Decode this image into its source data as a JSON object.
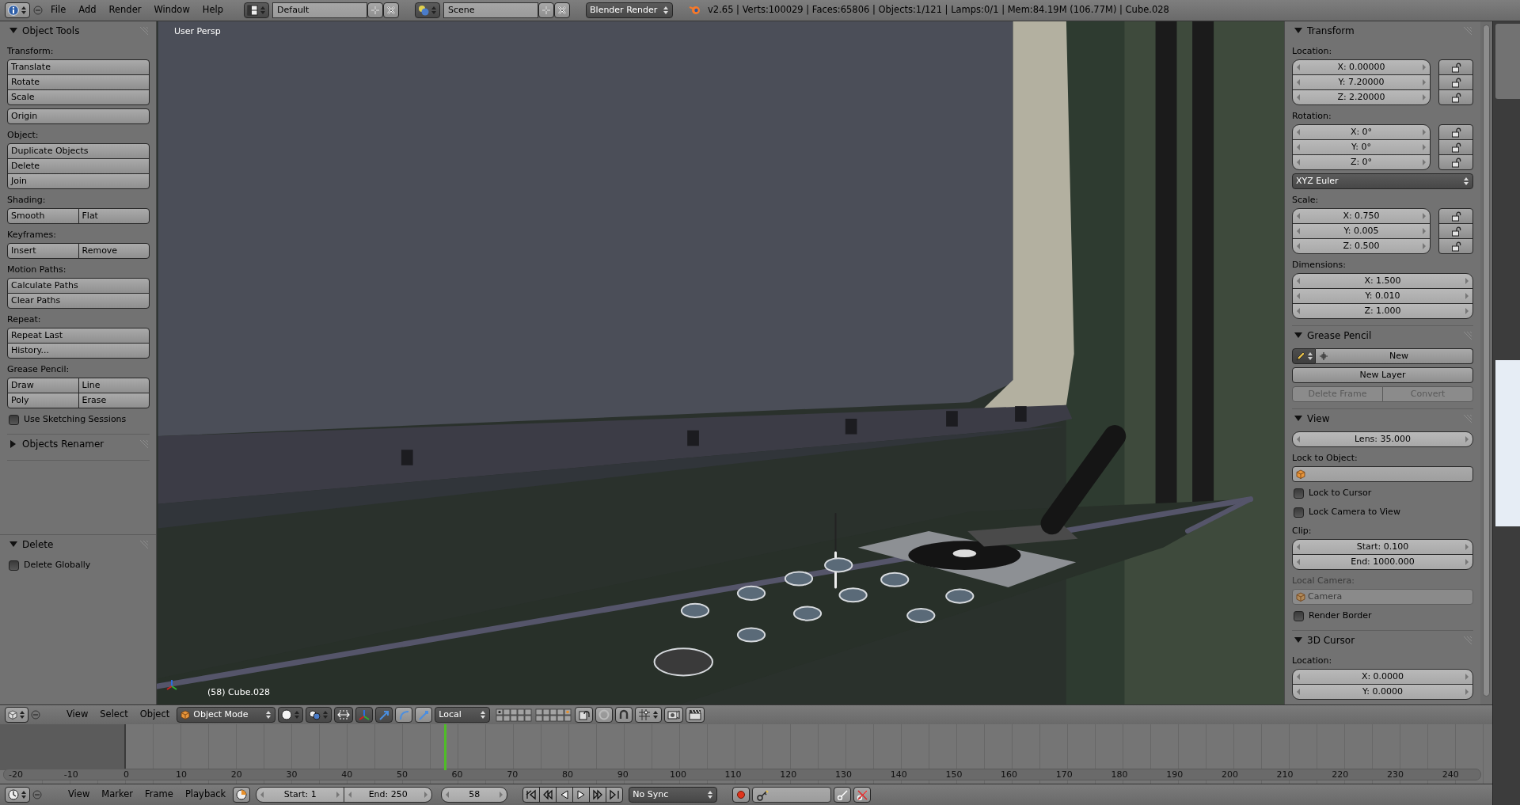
{
  "top_bar": {
    "menus": [
      "File",
      "Add",
      "Render",
      "Window",
      "Help"
    ],
    "screen_layout": "Default",
    "scene": "Scene",
    "render_engine": "Blender Render",
    "stats": "v2.65 | Verts:100029 | Faces:65806 | Objects:1/121 | Lamps:0/1 | Mem:84.19M (106.77M) | Cube.028"
  },
  "tool_shelf": {
    "panels": [
      {
        "title": "Object Tools",
        "expanded": true,
        "items": [
          {
            "kind": "label",
            "text": "Transform:"
          },
          {
            "kind": "buttons",
            "rows": [
              [
                "Translate"
              ],
              [
                "Rotate"
              ],
              [
                "Scale"
              ]
            ]
          },
          {
            "kind": "buttons",
            "rows": [
              [
                "Origin"
              ]
            ]
          },
          {
            "kind": "label",
            "text": "Object:"
          },
          {
            "kind": "buttons",
            "rows": [
              [
                "Duplicate Objects"
              ],
              [
                "Delete"
              ],
              [
                "Join"
              ]
            ]
          },
          {
            "kind": "label",
            "text": "Shading:"
          },
          {
            "kind": "buttons",
            "rows": [
              [
                "Smooth",
                "Flat"
              ]
            ]
          },
          {
            "kind": "label",
            "text": "Keyframes:"
          },
          {
            "kind": "buttons",
            "rows": [
              [
                "Insert",
                "Remove"
              ]
            ]
          },
          {
            "kind": "label",
            "text": "Motion Paths:"
          },
          {
            "kind": "buttons",
            "rows": [
              [
                "Calculate Paths"
              ],
              [
                "Clear Paths"
              ]
            ]
          },
          {
            "kind": "label",
            "text": "Repeat:"
          },
          {
            "kind": "buttons",
            "rows": [
              [
                "Repeat Last"
              ],
              [
                "History..."
              ]
            ]
          },
          {
            "kind": "label",
            "text": "Grease Pencil:"
          },
          {
            "kind": "buttons",
            "rows": [
              [
                "Draw",
                "Line"
              ],
              [
                "Poly",
                "Erase"
              ]
            ]
          },
          {
            "kind": "checkbox",
            "text": "Use Sketching Sessions",
            "checked": false
          }
        ]
      },
      {
        "title": "Objects Renamer",
        "expanded": false
      }
    ],
    "operator_panel": {
      "title": "Delete",
      "expanded": true,
      "items": [
        {
          "kind": "checkbox",
          "text": "Delete Globally",
          "checked": false
        }
      ]
    }
  },
  "viewport": {
    "view_name": "User Persp",
    "object_info": "(58) Cube.028"
  },
  "properties": {
    "panels": [
      {
        "title": "Transform",
        "expanded": true,
        "items": [
          {
            "kind": "label",
            "text": "Location:"
          },
          {
            "kind": "fields",
            "fields": [
              {
                "text": "X: 0.00000",
                "locked": false
              },
              {
                "text": "Y: 7.20000",
                "locked": false
              },
              {
                "text": "Z: 2.20000",
                "locked": false
              }
            ]
          },
          {
            "kind": "label",
            "text": "Rotation:"
          },
          {
            "kind": "fields",
            "fields": [
              {
                "text": "X: 0°",
                "locked": false
              },
              {
                "text": "Y: 0°",
                "locked": false
              },
              {
                "text": "Z: 0°",
                "locked": false
              }
            ]
          },
          {
            "kind": "dropdown",
            "text": "XYZ Euler"
          },
          {
            "kind": "label",
            "text": "Scale:"
          },
          {
            "kind": "fields",
            "fields": [
              {
                "text": "X: 0.750",
                "locked": false
              },
              {
                "text": "Y: 0.005",
                "locked": false
              },
              {
                "text": "Z: 0.500",
                "locked": false
              }
            ]
          },
          {
            "kind": "label",
            "text": "Dimensions:"
          },
          {
            "kind": "fields",
            "fields": [
              {
                "text": "X: 1.500"
              },
              {
                "text": "Y: 0.010"
              },
              {
                "text": "Z: 1.000"
              }
            ]
          }
        ]
      },
      {
        "title": "Grease Pencil",
        "expanded": true,
        "items": [
          {
            "kind": "datablock",
            "text": "New"
          },
          {
            "kind": "buttons",
            "disabled": false,
            "rows": [
              [
                "New Layer"
              ]
            ]
          },
          {
            "kind": "buttons",
            "disabled": true,
            "rows": [
              [
                "Delete Frame",
                "Convert"
              ]
            ]
          }
        ]
      },
      {
        "title": "View",
        "expanded": true,
        "items": [
          {
            "kind": "fields",
            "fields": [
              {
                "text": "Lens: 35.000"
              }
            ]
          },
          {
            "kind": "label",
            "text": "Lock to Object:"
          },
          {
            "kind": "object_field",
            "disabled": false
          },
          {
            "kind": "checkbox",
            "text": "Lock to Cursor",
            "checked": false
          },
          {
            "kind": "checkbox",
            "text": "Lock Camera to View",
            "checked": false
          },
          {
            "kind": "label",
            "text": "Clip:"
          },
          {
            "kind": "fields",
            "fields": [
              {
                "text": "Start: 0.100"
              },
              {
                "text": "End: 1000.000"
              }
            ]
          },
          {
            "kind": "label",
            "text": "Local Camera:",
            "disabled": true
          },
          {
            "kind": "object_field",
            "text": "Camera",
            "disabled": true
          },
          {
            "kind": "checkbox",
            "text": "Render Border",
            "checked": false
          }
        ]
      },
      {
        "title": "3D Cursor",
        "expanded": true,
        "items": [
          {
            "kind": "label",
            "text": "Location:"
          },
          {
            "kind": "fields",
            "fields": [
              {
                "text": "X: 0.0000"
              },
              {
                "text": "Y: 0.0000"
              }
            ]
          }
        ]
      }
    ]
  },
  "view_header": {
    "menus": [
      "View",
      "Select",
      "Object"
    ],
    "mode": "Object Mode",
    "orientation": "Local"
  },
  "timeline": {
    "ruler": [
      "-20",
      "-10",
      "0",
      "10",
      "20",
      "30",
      "40",
      "50",
      "60",
      "70",
      "80",
      "90",
      "100",
      "110",
      "120",
      "130",
      "140",
      "150",
      "160",
      "170",
      "180",
      "190",
      "200",
      "210",
      "220",
      "230",
      "240"
    ],
    "playhead": {
      "level": 0.298
    }
  },
  "timeline_header": {
    "menus": [
      "View",
      "Marker",
      "Frame",
      "Playback"
    ],
    "start": "Start: 1",
    "end": "End: 250",
    "current_frame": "58",
    "sync": "No Sync"
  }
}
